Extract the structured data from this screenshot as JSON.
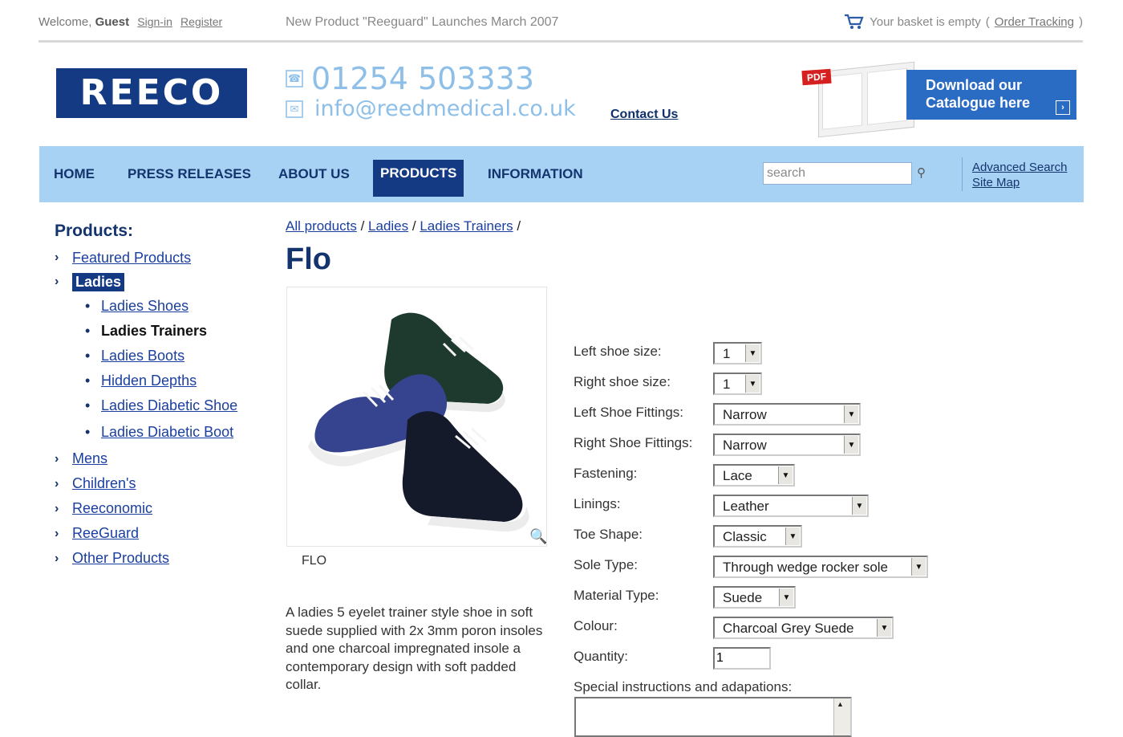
{
  "topbar": {
    "welcome": "Welcome,",
    "guest": "Guest",
    "signin": "Sign-in",
    "register": "Register",
    "news": "New Product \"Reeguard\" Launches March 2007",
    "basket": "Your basket is empty",
    "order_tracking": "Order Tracking"
  },
  "header": {
    "logo": "REECO",
    "phone": "01254 503333",
    "email": "info@reedmedical.co.uk",
    "contact": "Contact Us",
    "catalogue_line1": "Download our",
    "catalogue_line2": "Catalogue here",
    "pdf_badge": "PDF"
  },
  "nav": {
    "items": [
      "HOME",
      "PRESS RELEASES",
      "ABOUT US",
      "PRODUCTS",
      "INFORMATION"
    ],
    "active": "PRODUCTS",
    "search_placeholder": "search",
    "advanced_search": "Advanced Search",
    "site_map": "Site Map"
  },
  "sidebar": {
    "title": "Products:",
    "featured": "Featured Products",
    "ladies": "Ladies",
    "sub": [
      "Ladies Shoes",
      "Ladies Trainers",
      "Ladies Boots",
      "Hidden Depths",
      "Ladies Diabetic Shoe",
      "Ladies Diabetic Boot"
    ],
    "others": [
      "Mens",
      "Children's",
      "Reeconomic",
      "ReeGuard",
      "Other Products"
    ]
  },
  "breadcrumb": {
    "items": [
      "All products",
      "Ladies",
      "Ladies Trainers"
    ],
    "sep": "/"
  },
  "product": {
    "title": "Flo",
    "caption": "FLO",
    "description": "A ladies 5 eyelet trainer style shoe in soft suede supplied with 2x 3mm poron insoles and one charcoal impregnated insole a contemporary design with soft padded collar."
  },
  "form": {
    "left_size_label": "Left shoe size:",
    "left_size": "1",
    "right_size_label": "Right shoe size:",
    "right_size": "1",
    "left_fit_label": "Left Shoe Fittings:",
    "left_fit": "Narrow",
    "right_fit_label": "Right Shoe Fittings:",
    "right_fit": "Narrow",
    "fastening_label": "Fastening:",
    "fastening": "Lace",
    "linings_label": "Linings:",
    "linings": "Leather",
    "toe_label": "Toe Shape:",
    "toe": "Classic",
    "sole_label": "Sole Type:",
    "sole": "Through wedge rocker sole",
    "material_label": "Material Type:",
    "material": "Suede",
    "colour_label": "Colour:",
    "colour": "Charcoal Grey Suede",
    "quantity_label": "Quantity:",
    "quantity": "1",
    "special_label": "Special instructions and adapations:"
  },
  "colors": {
    "navy": "#133a82",
    "nav_bg": "#a8d2f4",
    "link": "#1a3f9e",
    "phone": "#8dbfe8"
  }
}
